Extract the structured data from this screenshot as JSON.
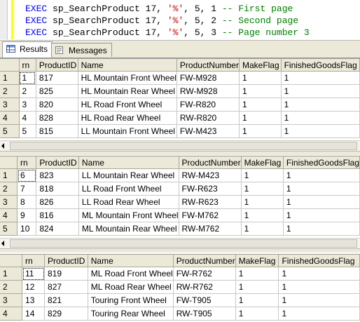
{
  "editor": {
    "lines": [
      {
        "kw": "EXEC",
        "proc": " sp_SearchProduct 17, ",
        "str": "'%'",
        "args": ", 5, 1 ",
        "comment": "-- First page"
      },
      {
        "kw": "EXEC",
        "proc": " sp_SearchProduct 17, ",
        "str": "'%'",
        "args": ", 5, 2 ",
        "comment": "-- Second page"
      },
      {
        "kw": "EXEC",
        "proc": " sp_SearchProduct 17, ",
        "str": "'%'",
        "args": ", 5, 3 ",
        "comment": "-- Page number 3"
      }
    ]
  },
  "tabs": {
    "results": "Results",
    "messages": "Messages"
  },
  "grids": [
    {
      "headers": [
        "rn",
        "ProductID",
        "Name",
        "ProductNumber",
        "MakeFlag",
        "FinishedGoodsFlag"
      ],
      "rows": [
        {
          "n": "1",
          "rn": "1",
          "id": "817",
          "name": "HL Mountain Front Wheel",
          "pn": "FW-M928",
          "mf": "1",
          "fg": "1"
        },
        {
          "n": "2",
          "rn": "2",
          "id": "825",
          "name": "HL Mountain Rear Wheel",
          "pn": "RW-M928",
          "mf": "1",
          "fg": "1"
        },
        {
          "n": "3",
          "rn": "3",
          "id": "820",
          "name": "HL Road Front Wheel",
          "pn": "FW-R820",
          "mf": "1",
          "fg": "1"
        },
        {
          "n": "4",
          "rn": "4",
          "id": "828",
          "name": "HL Road Rear Wheel",
          "pn": "RW-R820",
          "mf": "1",
          "fg": "1"
        },
        {
          "n": "5",
          "rn": "5",
          "id": "815",
          "name": "LL Mountain Front Wheel",
          "pn": "FW-M423",
          "mf": "1",
          "fg": "1"
        }
      ]
    },
    {
      "headers": [
        "rn",
        "ProductID",
        "Name",
        "ProductNumber",
        "MakeFlag",
        "FinishedGoodsFlag"
      ],
      "rows": [
        {
          "n": "1",
          "rn": "6",
          "id": "823",
          "name": "LL Mountain Rear Wheel",
          "pn": "RW-M423",
          "mf": "1",
          "fg": "1"
        },
        {
          "n": "2",
          "rn": "7",
          "id": "818",
          "name": "LL Road Front Wheel",
          "pn": "FW-R623",
          "mf": "1",
          "fg": "1"
        },
        {
          "n": "3",
          "rn": "8",
          "id": "826",
          "name": "LL Road Rear Wheel",
          "pn": "RW-R623",
          "mf": "1",
          "fg": "1"
        },
        {
          "n": "4",
          "rn": "9",
          "id": "816",
          "name": "ML Mountain Front Wheel",
          "pn": "FW-M762",
          "mf": "1",
          "fg": "1"
        },
        {
          "n": "5",
          "rn": "10",
          "id": "824",
          "name": "ML Mountain Rear Wheel",
          "pn": "RW-M762",
          "mf": "1",
          "fg": "1"
        }
      ]
    },
    {
      "headers": [
        "rn",
        "ProductID",
        "Name",
        "ProductNumber",
        "MakeFlag",
        "FinishedGoodsFlag"
      ],
      "rows": [
        {
          "n": "1",
          "rn": "11",
          "id": "819",
          "name": "ML Road Front Wheel",
          "pn": "FW-R762",
          "mf": "1",
          "fg": "1"
        },
        {
          "n": "2",
          "rn": "12",
          "id": "827",
          "name": "ML Road Rear Wheel",
          "pn": "RW-R762",
          "mf": "1",
          "fg": "1"
        },
        {
          "n": "3",
          "rn": "13",
          "id": "821",
          "name": "Touring Front Wheel",
          "pn": "FW-T905",
          "mf": "1",
          "fg": "1"
        },
        {
          "n": "4",
          "rn": "14",
          "id": "829",
          "name": "Touring Rear Wheel",
          "pn": "RW-T905",
          "mf": "1",
          "fg": "1"
        }
      ]
    }
  ]
}
